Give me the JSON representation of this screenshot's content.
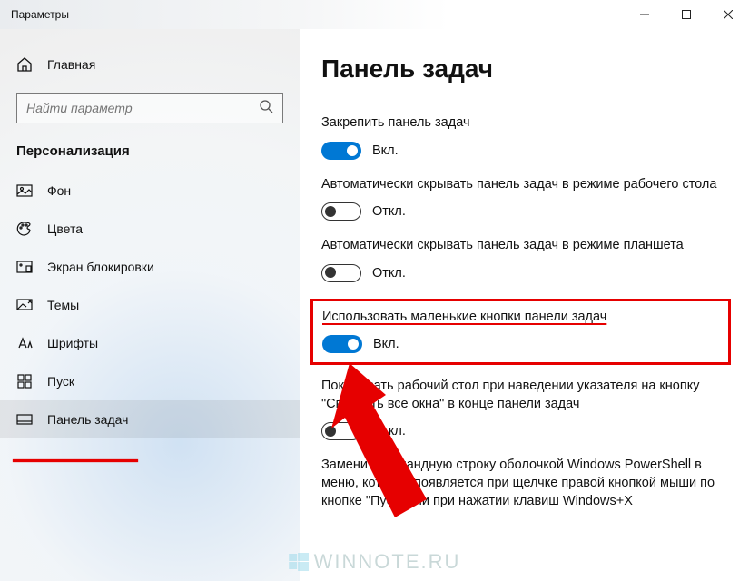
{
  "window": {
    "title": "Параметры"
  },
  "sidebar": {
    "home": "Главная",
    "search_placeholder": "Найти параметр",
    "section": "Персонализация",
    "items": [
      {
        "label": "Фон"
      },
      {
        "label": "Цвета"
      },
      {
        "label": "Экран блокировки"
      },
      {
        "label": "Темы"
      },
      {
        "label": "Шрифты"
      },
      {
        "label": "Пуск"
      },
      {
        "label": "Панель задач"
      }
    ]
  },
  "main": {
    "title": "Панель задач",
    "settings": [
      {
        "label": "Закрепить панель задач",
        "state": "on",
        "state_text": "Вкл."
      },
      {
        "label": "Автоматически скрывать панель задач в режиме рабочего стола",
        "state": "off",
        "state_text": "Откл."
      },
      {
        "label": "Автоматически скрывать панель задач в режиме планшета",
        "state": "off",
        "state_text": "Откл."
      },
      {
        "label": "Использовать маленькие кнопки панели задач",
        "state": "on",
        "state_text": "Вкл."
      },
      {
        "label": "Показывать рабочий стол при наведении указателя на кнопку \"Свернуть все окна\" в конце панели задач",
        "state": "off",
        "state_text": "Откл."
      },
      {
        "label": "Заменить командную строку оболочкой Windows PowerShell в меню, которое появляется при щелчке правой кнопкой мыши по кнопке \"Пуск\" или при нажатии клавиш Windows+X"
      }
    ]
  },
  "watermark": "WINNOTE.RU",
  "annotation": {
    "highlight_index": 3
  }
}
